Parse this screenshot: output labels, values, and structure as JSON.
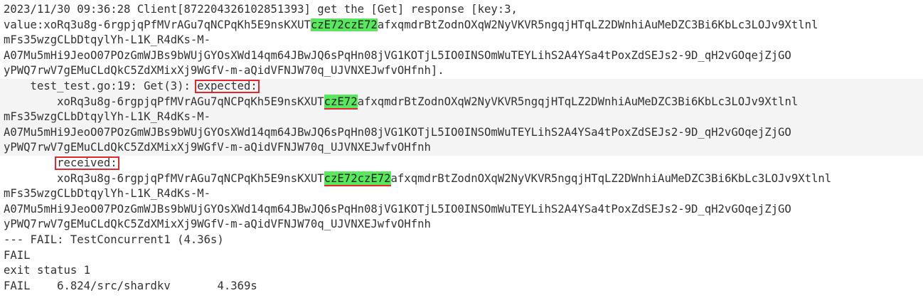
{
  "log": {
    "l1": "2023/11/30 09:36:28 Client[872204326102851393] get the [Get] response [key:3,",
    "l2_pre": "value:xoRq3u8g-6rgpjqPfMVrAGu7qNCPqKh5E9nsKXUT",
    "l2_hl": "czE72czE72",
    "l2_post": "afxqmdrBtZodnOXqW2NyVKVR5ngqjHTqLZ2DWnhiAuMeDZC3Bi6KbLc3LOJv9Xtlnl",
    "l3": "mFs35wzgCLbDtqylYh-L1K_R4dKs-M-",
    "l4": "A07Mu5mHi9JeoO07POzGmWJBs9bWUjGYOsXWd14qm64JBwJQ6sPqHn08jVG1KOTjL5IO0INSOmWuTEYLihS2A4YSa4tPoxZdSEJs2-9D_qH2vGOqejZjGO",
    "l5": "yPWQ7rwV7gEMuCLdQkC5ZdXMixXj9WGfV-m-aQidVFNJW70q_UJVNXEJwfvOHfnh].",
    "l6_pre": "    test_test.go:19: Get(3): ",
    "l6_box": "expected:",
    "l7_pre": "        xoRq3u8g-6rgpjqPfMVrAGu7qNCPqKh5E9nsKXUT",
    "l7_hl": "czE72",
    "l7_post": "afxqmdrBtZodnOXqW2NyVKVR5ngqjHTqLZ2DWnhiAuMeDZC3Bi6KbLc3LOJv9Xtlnl",
    "l8": "mFs35wzgCLbDtqylYh-L1K_R4dKs-M-",
    "l9": "A07Mu5mHi9JeoO07POzGmWJBs9bWUjGYOsXWd14qm64JBwJQ6sPqHn08jVG1KOTjL5IO0INSOmWuTEYLihS2A4YSa4tPoxZdSEJs2-9D_qH2vGOqejZjGO",
    "l10": "yPWQ7rwV7gEMuCLdQkC5ZdXMixXj9WGfV-m-aQidVFNJW70q_UJVNXEJwfvOHfnh",
    "l11_pre": "        ",
    "l11_box": "received:",
    "l12_pre": "        xoRq3u8g-6rgpjqPfMVrAGu7qNCPqKh5E9nsKXUT",
    "l12_hl": "czE72czE72",
    "l12_post": "afxqmdrBtZodnOXqW2NyVKVR5ngqjHTqLZ2DWnhiAuMeDZC3Bi6KbLc3LOJv9Xtlnl",
    "l13": "mFs35wzgCLbDtqylYh-L1K_R4dKs-M-",
    "l14": "A07Mu5mHi9JeoO07POzGmWJBs9bWUjGYOsXWd14qm64JBwJQ6sPqHn08jVG1KOTjL5IO0INSOmWuTEYLihS2A4YSa4tPoxZdSEJs2-9D_qH2vGOqejZjGO",
    "l15": "yPWQ7rwV7gEMuCLdQkC5ZdXMixXj9WGfV-m-aQidVFNJW70q_UJVNXEJwfvOHfnh",
    "l16": "--- FAIL: TestConcurrent1 (4.36s)",
    "l17": "FAIL",
    "l18": "exit status 1",
    "l19": "FAIL\t6.824/src/shardkv\t4.369s"
  },
  "colors": {
    "highlight": "#58e85c",
    "annotation_red": "#e0282e",
    "text": "#333333"
  }
}
